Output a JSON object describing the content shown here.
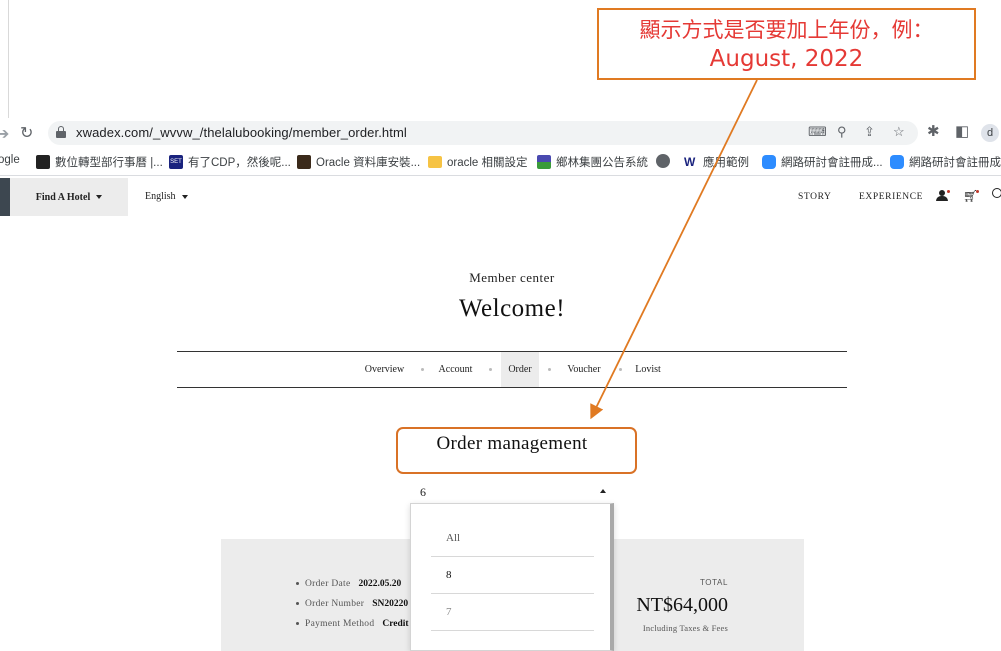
{
  "browser": {
    "url": "xwadex.com/_wvvw_/thelalubooking/member_order.html",
    "bookmarks": [
      {
        "label": "ogle",
        "icon": "google-icon"
      },
      {
        "label": "數位轉型部行事曆 |...",
        "icon": "calendar-app-icon"
      },
      {
        "label": "有了CDP，然後呢...",
        "icon": "set-news-icon"
      },
      {
        "label": "Oracle 資料庫安裝...",
        "icon": "oracle-book-icon"
      },
      {
        "label": "oracle 相關設定",
        "icon": "folder-icon"
      },
      {
        "label": "鄉林集團公告系統",
        "icon": "site-logo-icon"
      },
      {
        "label": "",
        "icon": "globe-icon"
      },
      {
        "label": "應用範例",
        "icon": "webflow-icon"
      },
      {
        "label": "網路研討會註冊成...",
        "icon": "zoom-icon"
      },
      {
        "label": "網路研討會註冊成...",
        "icon": "zoom-icon"
      }
    ],
    "profile_initial": "d"
  },
  "site_nav": {
    "find_hotel": "Find A Hotel",
    "language": "English",
    "links": [
      "STORY",
      "EXPERIENCE"
    ]
  },
  "member": {
    "subtitle": "Member center",
    "welcome": "Welcome!",
    "tabs": [
      "Overview",
      "Account",
      "Order",
      "Voucher",
      "Lovist"
    ],
    "active_tab": "Order",
    "section_title": "Order management",
    "month_select": {
      "value": "6",
      "options": [
        "All",
        "8",
        "7"
      ],
      "hovered_option": "8"
    }
  },
  "order": {
    "date_label": "Order Date",
    "date_value": "2022.05.20",
    "number_label": "Order Number",
    "number_value": "SN20220",
    "payment_label": "Payment Method",
    "payment_value": "Credit",
    "total_label": "TOTAL",
    "total_amount": "NT$64,000",
    "tax_note": "Including Taxes & Fees"
  },
  "annotation": {
    "line1": "顯示方式是否要加上年份，例：",
    "line2": "August, 2022",
    "color": "#e53935",
    "border_color": "#e07a22"
  }
}
